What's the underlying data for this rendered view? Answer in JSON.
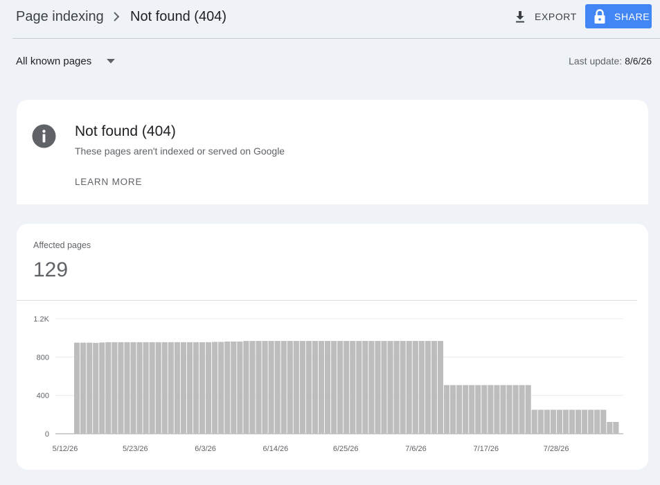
{
  "header": {
    "breadcrumb_parent": "Page indexing",
    "breadcrumb_current": "Not found (404)",
    "export_label": "EXPORT",
    "share_label": "SHARE"
  },
  "filter": {
    "selected": "All known pages"
  },
  "last_update": {
    "label": "Last update:",
    "value": "8/6/26"
  },
  "info_card": {
    "title": "Not found (404)",
    "description": "These pages aren't indexed or served on Google",
    "learn_more": "LEARN MORE"
  },
  "metric": {
    "label": "Affected pages",
    "value": "129"
  },
  "colors": {
    "accent": "#4285f4",
    "bar": "#bdbdbd",
    "background": "#eff3f8"
  },
  "chart_data": {
    "type": "bar",
    "x_tick_labels": [
      "5/12/26",
      "5/23/26",
      "6/3/26",
      "6/14/26",
      "6/25/26",
      "7/6/26",
      "7/17/26",
      "7/28/26"
    ],
    "y_tick_labels": [
      "0",
      "400",
      "800",
      "1.2K"
    ],
    "ylim": [
      0,
      1200
    ],
    "grid": true,
    "values": [
      950,
      950,
      950,
      948,
      952,
      955,
      955,
      955,
      955,
      955,
      955,
      955,
      955,
      955,
      955,
      955,
      955,
      955,
      955,
      955,
      955,
      955,
      958,
      958,
      962,
      962,
      962,
      968,
      968,
      968,
      968,
      968,
      968,
      968,
      968,
      968,
      968,
      968,
      968,
      968,
      968,
      968,
      968,
      968,
      968,
      968,
      968,
      968,
      968,
      968,
      968,
      968,
      968,
      968,
      968,
      968,
      968,
      968,
      968,
      508,
      508,
      508,
      508,
      508,
      508,
      508,
      508,
      508,
      508,
      508,
      508,
      508,
      508,
      250,
      250,
      250,
      250,
      250,
      250,
      250,
      250,
      250,
      250,
      250,
      250,
      123,
      123
    ]
  }
}
